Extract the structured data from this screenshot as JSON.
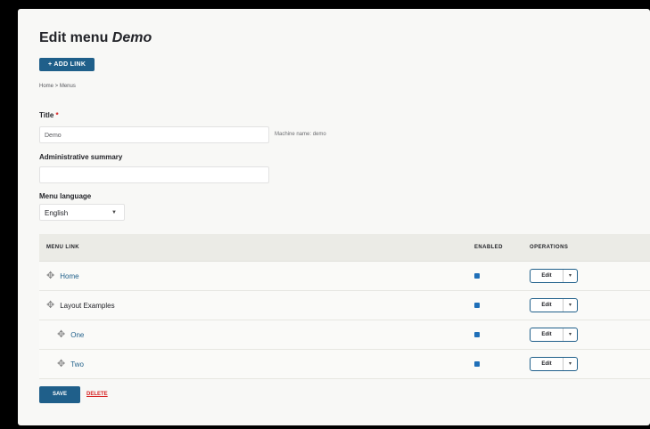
{
  "page": {
    "title_prefix": "Edit menu ",
    "title_name": "Demo",
    "add_link_button": "+ ADD LINK",
    "breadcrumb": "Home > Menus"
  },
  "form": {
    "title_label": "Title",
    "title_required": "*",
    "title_value": "Demo",
    "machine_name": "Machine name: demo",
    "summary_label": "Administrative summary",
    "summary_value": "",
    "language_label": "Menu language",
    "language_value": "English"
  },
  "table": {
    "headers": {
      "link": "MENU LINK",
      "enabled": "ENABLED",
      "operations": "OPERATIONS"
    },
    "rows": [
      {
        "label": "Home",
        "is_link": true,
        "enabled": true,
        "op": "Edit"
      },
      {
        "label": "Layout Examples",
        "is_link": false,
        "enabled": true,
        "op": "Edit"
      },
      {
        "label": "One",
        "is_link": true,
        "enabled": true,
        "op": "Edit"
      },
      {
        "label": "Two",
        "is_link": true,
        "enabled": true,
        "op": "Edit"
      }
    ]
  },
  "actions": {
    "save": "SAVE",
    "delete": "DELETE"
  },
  "colors": {
    "primary": "#1f5f8a",
    "danger": "#d72222",
    "checkbox": "#1f6fb8"
  },
  "icons": {
    "drag": "drag-handle-icon",
    "dropdown": "chevron-down-icon"
  }
}
